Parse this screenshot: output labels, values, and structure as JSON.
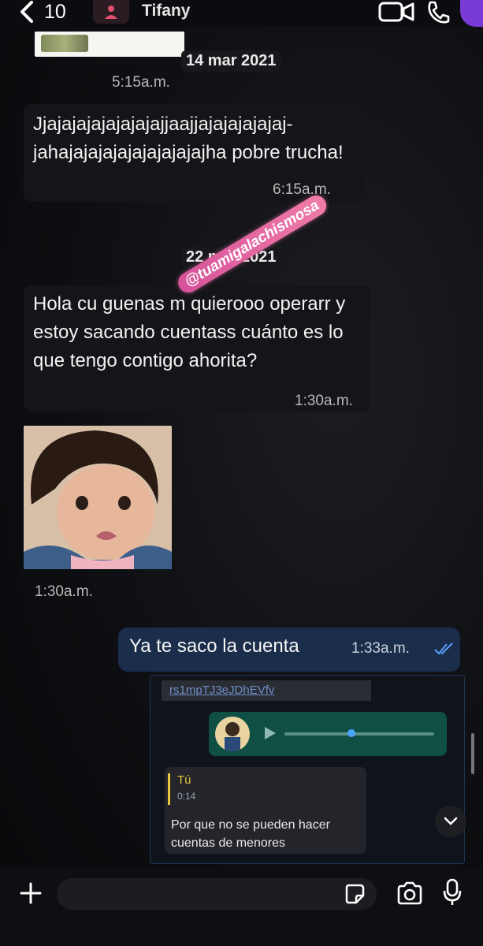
{
  "header": {
    "back_count": "10",
    "contact_name": "Tifany"
  },
  "messages": {
    "date_1": "14 mar 2021",
    "time_image_1": "5:15a.m.",
    "msg_1_text": "Jjajajajajajajajajjaajjajajajajajaj-jahajajajajajajajajajajha pobre trucha!",
    "msg_1_time": "6:15a.m.",
    "date_2": "22 mar 2021",
    "msg_2_text": "Hola cu guenas m quierooo operarr y estoy sacando cuentass cuánto es lo que tengo contigo ahorita?",
    "msg_2_time": "1:30a.m.",
    "image_time": "1:30a.m.",
    "out_text": "Ya te saco la cuenta",
    "out_time": "1:33a.m."
  },
  "watermark": "@tuamigalachismosa",
  "embedded_screenshot": {
    "link_text": "rs1mpTJ3eJDhEVfv",
    "reply_author": "Tú",
    "reply_meta": "0:14",
    "reply_text": "Por que no se pueden hacer cuentas de menores"
  },
  "colors": {
    "outgoing_bubble": "#1a2d4a",
    "voice_note": "#0f4f44",
    "watermark_pink": "#d6529a"
  }
}
